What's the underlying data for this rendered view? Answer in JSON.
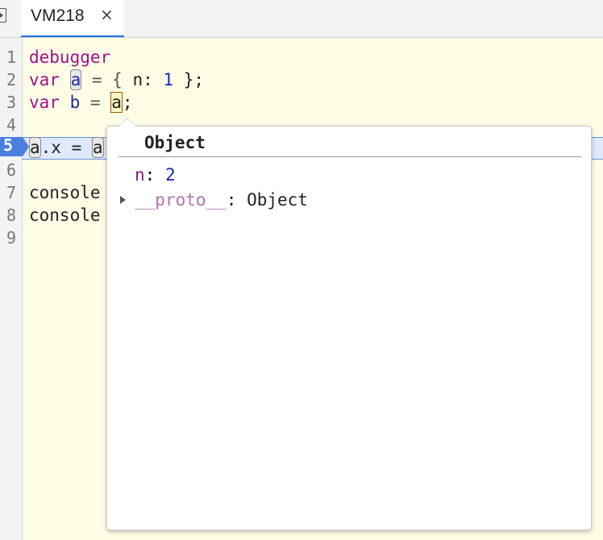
{
  "tab": {
    "label": "VM218",
    "close": "×"
  },
  "gutter": {
    "numbers": [
      "1",
      "2",
      "3",
      "4",
      "5",
      "6",
      "7",
      "8",
      "9"
    ],
    "active_line": "5"
  },
  "code": {
    "line1": "debugger",
    "line2_kw": "var",
    "line2_var": "a",
    "line2_rest_open": " = { ",
    "line2_key": "n",
    "line2_colon": ": ",
    "line2_num": "1",
    "line2_close": " };",
    "line3_kw": "var",
    "line3_var": "b",
    "line3_eq": " = ",
    "line3_hover": "a",
    "line3_end": ";",
    "line5_a": "a",
    "line5_rest": ".x = ",
    "line5_a2": "a",
    "line7": "console",
    "line8": "console"
  },
  "popover": {
    "title": "Object",
    "props": [
      {
        "key": "n",
        "value": "2"
      }
    ],
    "proto": {
      "key": "__proto__",
      "value": "Object"
    }
  },
  "colors": {
    "keyword": "#a1108c",
    "number": "#1b27c9",
    "variable": "#1b27a6",
    "editor_bg": "#fffde6",
    "exec_line": "#dfe9fb",
    "tab_underline": "#1a73e8"
  }
}
